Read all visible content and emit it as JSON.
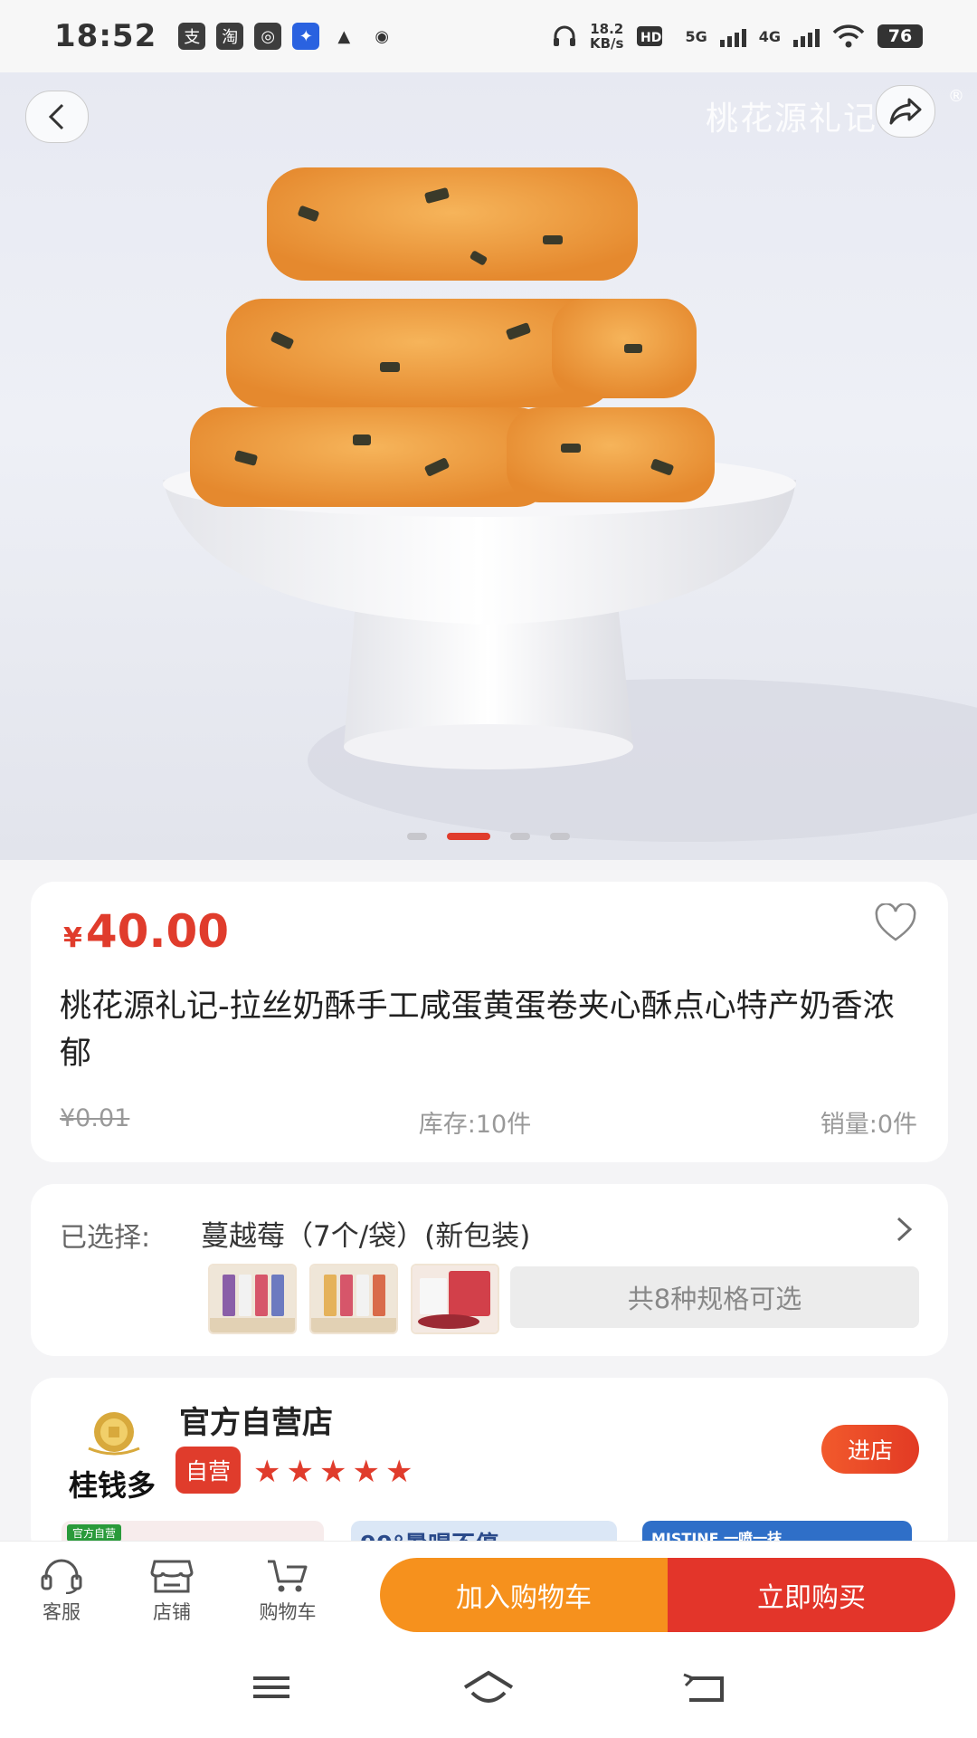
{
  "status_bar": {
    "time": "18:52",
    "app_icons": [
      "支",
      "淘",
      "◎",
      "✦",
      "▲",
      "◉"
    ],
    "speed_value": "18.2",
    "speed_unit": "KB/s",
    "network_1": "5G",
    "network_2": "4G",
    "battery": "76"
  },
  "hero": {
    "brand_watermark": "桃花源礼记",
    "registered_mark": "®",
    "page_count": 4,
    "active_page": 2
  },
  "product": {
    "currency": "¥",
    "price": "40.00",
    "title": "桃花源礼记-拉丝奶酥手工咸蛋黄蛋卷夹心酥点心特产奶香浓郁",
    "original_price": "¥0.01",
    "stock": "库存:10件",
    "sales": "销量:0件"
  },
  "selection": {
    "label": "已选择:",
    "value": "蔓越莓（7个/袋）(新包装)",
    "spec_count": "共8种规格可选"
  },
  "shop": {
    "logo_text": "桂钱多",
    "name": "官方自营店",
    "badge": "自营",
    "rating": 5,
    "enter_label": "进店",
    "promo_texts": [
      "官方自营",
      "99°暑喝不停",
      "MISTINE 一喷一抹"
    ]
  },
  "bottom_bar": {
    "service_label": "客服",
    "store_label": "店铺",
    "cart_label": "购物车",
    "add_cart_label": "加入购物车",
    "buy_now_label": "立即购买"
  },
  "colors": {
    "accent_red": "#e03c2c",
    "accent_orange": "#f6911d"
  }
}
